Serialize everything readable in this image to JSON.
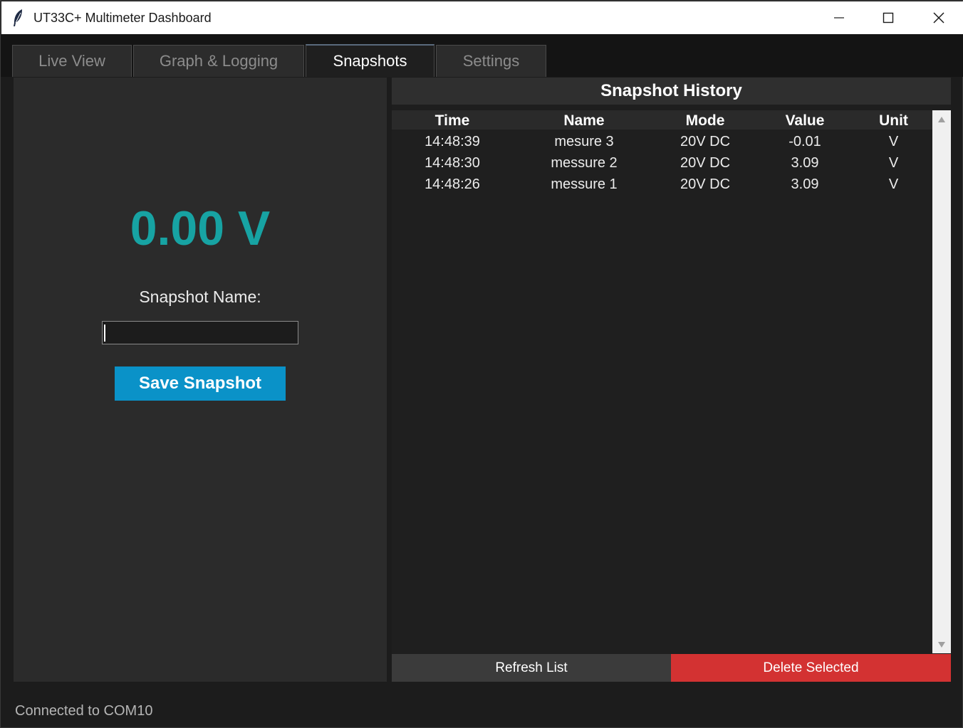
{
  "window": {
    "title": "UT33C+ Multimeter Dashboard"
  },
  "tabs": [
    {
      "label": "Live View",
      "active": false
    },
    {
      "label": "Graph & Logging",
      "active": false
    },
    {
      "label": "Snapshots",
      "active": true
    },
    {
      "label": "Settings",
      "active": false
    }
  ],
  "left": {
    "reading": "0.00 V",
    "name_label": "Snapshot Name:",
    "name_value": "",
    "save_label": "Save Snapshot"
  },
  "history": {
    "title": "Snapshot History",
    "columns": [
      "Time",
      "Name",
      "Mode",
      "Value",
      "Unit"
    ],
    "rows": [
      {
        "time": "14:48:39",
        "name": "mesure 3",
        "mode": "20V DC",
        "value": "-0.01",
        "unit": "V"
      },
      {
        "time": "14:48:30",
        "name": "messure 2",
        "mode": "20V DC",
        "value": "3.09",
        "unit": "V"
      },
      {
        "time": "14:48:26",
        "name": "messure 1",
        "mode": "20V DC",
        "value": "3.09",
        "unit": "V"
      }
    ],
    "refresh_label": "Refresh List",
    "delete_label": "Delete Selected"
  },
  "status": "Connected to COM10",
  "colors": {
    "reading": "#17a3a3",
    "save_button": "#0a92c8",
    "delete_button": "#d33232"
  },
  "icons": {
    "app": "feather-icon",
    "minimize": "minimize-icon",
    "maximize": "maximize-icon",
    "close": "close-icon"
  }
}
